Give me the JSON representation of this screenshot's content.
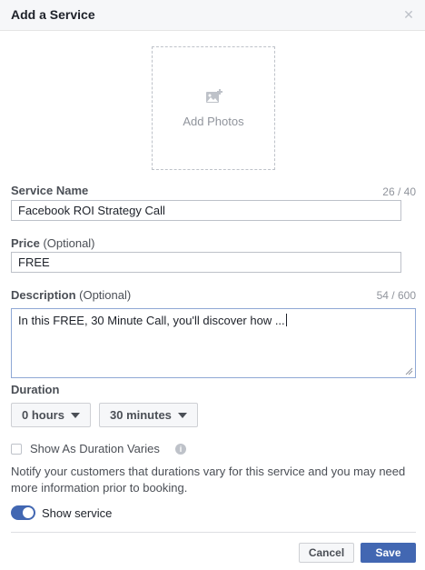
{
  "dialog": {
    "title": "Add a Service",
    "close_icon": "close-icon"
  },
  "photos": {
    "label": "Add Photos",
    "icon": "add-photo-icon"
  },
  "service_name": {
    "label": "Service Name",
    "counter": "26 / 40",
    "value": "Facebook ROI Strategy Call"
  },
  "price": {
    "label": "Price",
    "optional": "(Optional)",
    "value": "FREE"
  },
  "description": {
    "label": "Description",
    "optional": "(Optional)",
    "counter": "54 / 600",
    "value": "In this FREE, 30 Minute Call, you'll discover how ..."
  },
  "duration": {
    "label": "Duration",
    "hours": "0 hours",
    "minutes": "30 minutes"
  },
  "duration_varies": {
    "label": "Show As Duration Varies",
    "checked": false,
    "info_icon": "info-icon",
    "help": "Notify your customers that durations vary for this service and you may need more information prior to booking."
  },
  "show_service": {
    "label": "Show service",
    "enabled": true
  },
  "footer": {
    "cancel": "Cancel",
    "save": "Save"
  },
  "colors": {
    "accent": "#4267b2",
    "header_bg": "#f6f7f9",
    "muted_text": "#90949c"
  }
}
